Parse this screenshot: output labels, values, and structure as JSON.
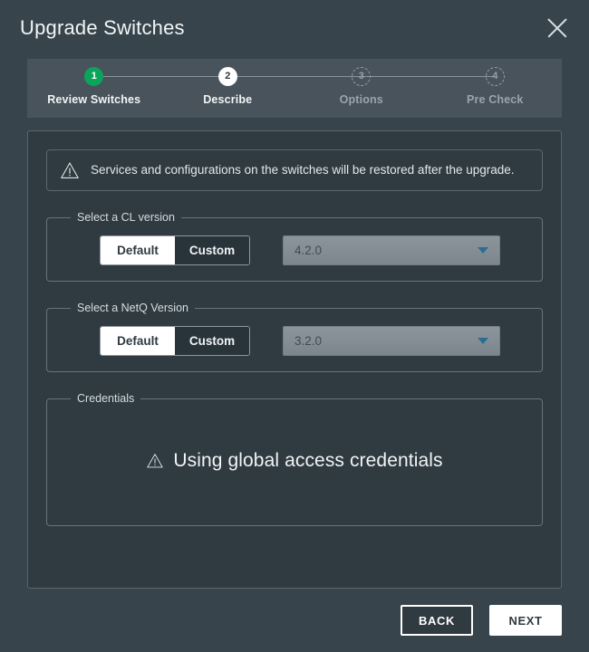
{
  "dialog": {
    "title": "Upgrade Switches",
    "close_icon": "close-icon"
  },
  "stepper": {
    "steps": [
      {
        "number": "1",
        "label": "Review Switches",
        "state": "done"
      },
      {
        "number": "2",
        "label": "Describe",
        "state": "current"
      },
      {
        "number": "3",
        "label": "Options",
        "state": "future"
      },
      {
        "number": "4",
        "label": "Pre Check",
        "state": "future"
      }
    ]
  },
  "warning": {
    "icon": "warning-triangle-icon",
    "message": "Services and configurations on the switches will be restored after the upgrade."
  },
  "cl_version": {
    "legend": "Select a CL version",
    "toggle": {
      "options": [
        "Default",
        "Custom"
      ],
      "selected": "Default"
    },
    "select": {
      "value": "4.2.0",
      "caret_icon": "chevron-down-icon",
      "disabled": true
    }
  },
  "netq_version": {
    "legend": "Select a NetQ Version",
    "toggle": {
      "options": [
        "Default",
        "Custom"
      ],
      "selected": "Default"
    },
    "select": {
      "value": "3.2.0",
      "caret_icon": "chevron-down-icon",
      "disabled": true
    }
  },
  "credentials": {
    "legend": "Credentials",
    "icon": "warning-triangle-icon",
    "message": "Using global access credentials"
  },
  "footer": {
    "back_label": "BACK",
    "next_label": "NEXT"
  },
  "colors": {
    "page_bg": "#37444c",
    "card_bg": "#2f3a41",
    "stepper_bg": "#49535b",
    "accent_green": "#0aa45a",
    "caret_blue": "#2a6d92",
    "border": "#5b666e"
  }
}
